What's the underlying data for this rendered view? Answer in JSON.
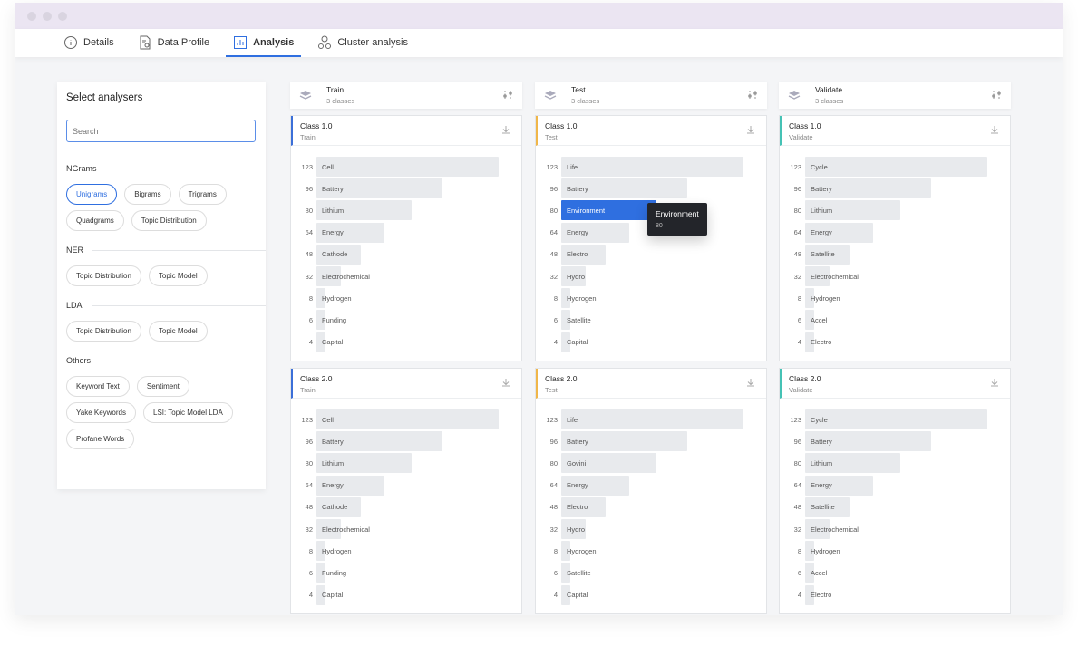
{
  "tabs": [
    {
      "label": "Details",
      "icon": "info-icon"
    },
    {
      "label": "Data Profile",
      "icon": "document-search-icon"
    },
    {
      "label": "Analysis",
      "icon": "bar-chart-icon",
      "active": true
    },
    {
      "label": "Cluster analysis",
      "icon": "cluster-icon"
    }
  ],
  "sidebar": {
    "title": "Select analysers",
    "search_placeholder": "Search",
    "sections": [
      {
        "title": "NGrams",
        "chips": [
          "Unigrams",
          "Bigrams",
          "Trigrams",
          "Quadgrams",
          "Topic Distribution"
        ],
        "selected": "Unigrams"
      },
      {
        "title": "NER",
        "chips": [
          "Topic Distribution",
          "Topic Model"
        ]
      },
      {
        "title": "LDA",
        "chips": [
          "Topic Distribution",
          "Topic Model"
        ]
      },
      {
        "title": "Others",
        "chips": [
          "Keyword Text",
          "Sentiment",
          "Yake Keywords",
          "LSI: Topic Model LDA",
          "Profane Words"
        ]
      }
    ]
  },
  "colors": {
    "Train": "#3b6fd8",
    "Test": "#f0b648",
    "Validate": "#45c2b5",
    "highlight": "#2f6fe0"
  },
  "columns": [
    {
      "title": "Train",
      "subtitle": "3 classes",
      "cards": [
        {
          "title": "Class 1.0",
          "subtitle": "Train",
          "rows": [
            [
              123,
              "Cell"
            ],
            [
              96,
              "Battery"
            ],
            [
              80,
              "Lithium"
            ],
            [
              64,
              "Energy"
            ],
            [
              48,
              "Cathode"
            ],
            [
              32,
              "Electrochemical"
            ],
            [
              8,
              "Hydrogen"
            ],
            [
              6,
              "Funding"
            ],
            [
              4,
              "Capital"
            ]
          ]
        },
        {
          "title": "Class 2.0",
          "subtitle": "Train",
          "rows": [
            [
              123,
              "Cell"
            ],
            [
              96,
              "Battery"
            ],
            [
              80,
              "Lithium"
            ],
            [
              64,
              "Energy"
            ],
            [
              48,
              "Cathode"
            ],
            [
              32,
              "Electrochemical"
            ],
            [
              8,
              "Hydrogen"
            ],
            [
              6,
              "Funding"
            ],
            [
              4,
              "Capital"
            ]
          ]
        }
      ]
    },
    {
      "title": "Test",
      "subtitle": "3 classes",
      "cards": [
        {
          "title": "Class 1.0",
          "subtitle": "Test",
          "highlight": 2,
          "rows": [
            [
              123,
              "Life"
            ],
            [
              96,
              "Battery"
            ],
            [
              80,
              "Environment"
            ],
            [
              64,
              "Energy"
            ],
            [
              48,
              "Electro"
            ],
            [
              32,
              "Hydro"
            ],
            [
              8,
              "Hydrogen"
            ],
            [
              6,
              "Satellite"
            ],
            [
              4,
              "Capital"
            ]
          ]
        },
        {
          "title": "Class 2.0",
          "subtitle": "Test",
          "rows": [
            [
              123,
              "Life"
            ],
            [
              96,
              "Battery"
            ],
            [
              80,
              "Govini"
            ],
            [
              64,
              "Energy"
            ],
            [
              48,
              "Electro"
            ],
            [
              32,
              "Hydro"
            ],
            [
              8,
              "Hydrogen"
            ],
            [
              6,
              "Satellite"
            ],
            [
              4,
              "Capital"
            ]
          ]
        }
      ]
    },
    {
      "title": "Validate",
      "subtitle": "3 classes",
      "cards": [
        {
          "title": "Class 1.0",
          "subtitle": "Validate",
          "rows": [
            [
              123,
              "Cycle"
            ],
            [
              96,
              "Battery"
            ],
            [
              80,
              "Lithium"
            ],
            [
              64,
              "Energy"
            ],
            [
              48,
              "Satellite"
            ],
            [
              32,
              "Electrochemical"
            ],
            [
              8,
              "Hydrogen"
            ],
            [
              6,
              "Accel"
            ],
            [
              4,
              "Electro"
            ]
          ]
        },
        {
          "title": "Class 2.0",
          "subtitle": "Validate",
          "rows": [
            [
              123,
              "Cycle"
            ],
            [
              96,
              "Battery"
            ],
            [
              80,
              "Lithium"
            ],
            [
              64,
              "Energy"
            ],
            [
              48,
              "Satellite"
            ],
            [
              32,
              "Electrochemical"
            ],
            [
              8,
              "Hydrogen"
            ],
            [
              6,
              "Accel"
            ],
            [
              4,
              "Electro"
            ]
          ]
        }
      ]
    }
  ],
  "tooltip": {
    "label": "Environment",
    "value": "80"
  }
}
